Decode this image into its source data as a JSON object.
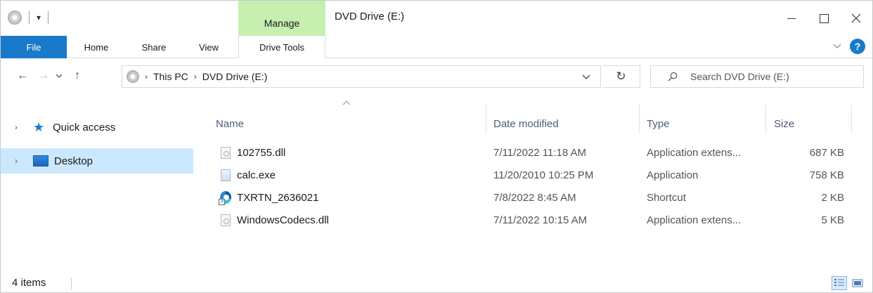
{
  "window": {
    "title": "DVD Drive (E:)",
    "context_tab_group": "Manage",
    "quick_access_dropdown": "▾"
  },
  "ribbon": {
    "tabs": [
      {
        "label": "File"
      },
      {
        "label": "Home"
      },
      {
        "label": "Share"
      },
      {
        "label": "View"
      },
      {
        "label": "Drive Tools"
      }
    ],
    "help_label": "?"
  },
  "nav": {
    "back_icon": "←",
    "forward_icon": "→",
    "recent_icon": "⌄",
    "up_icon": "↑",
    "breadcrumb": [
      "This PC",
      "DVD Drive (E:)"
    ],
    "refresh_icon": "↻"
  },
  "search": {
    "placeholder": "Search DVD Drive (E:)"
  },
  "sidebar": {
    "items": [
      {
        "label": "Quick access",
        "icon": "star-icon"
      },
      {
        "label": "Desktop",
        "icon": "desktop-icon",
        "selected": true
      }
    ]
  },
  "filelist": {
    "columns": {
      "name": "Name",
      "date": "Date modified",
      "type": "Type",
      "size": "Size"
    },
    "rows": [
      {
        "name": "102755.dll",
        "date": "7/11/2022 11:18 AM",
        "type": "Application extens...",
        "size": "687 KB",
        "icon": "dll-file-icon"
      },
      {
        "name": "calc.exe",
        "date": "11/20/2010 10:25 PM",
        "type": "Application",
        "size": "758 KB",
        "icon": "exe-file-icon"
      },
      {
        "name": "TXRTN_2636021",
        "date": "7/8/2022 8:45 AM",
        "type": "Shortcut",
        "size": "2 KB",
        "icon": "edge-shortcut-icon"
      },
      {
        "name": "WindowsCodecs.dll",
        "date": "7/11/2022 10:15 AM",
        "type": "Application extens...",
        "size": "5 KB",
        "icon": "dll-file-icon"
      }
    ]
  },
  "status": {
    "count": "4 items"
  },
  "colors": {
    "accent": "#1979ca",
    "manage_tab": "#c6efb0",
    "selected_nav": "#cce8ff"
  }
}
